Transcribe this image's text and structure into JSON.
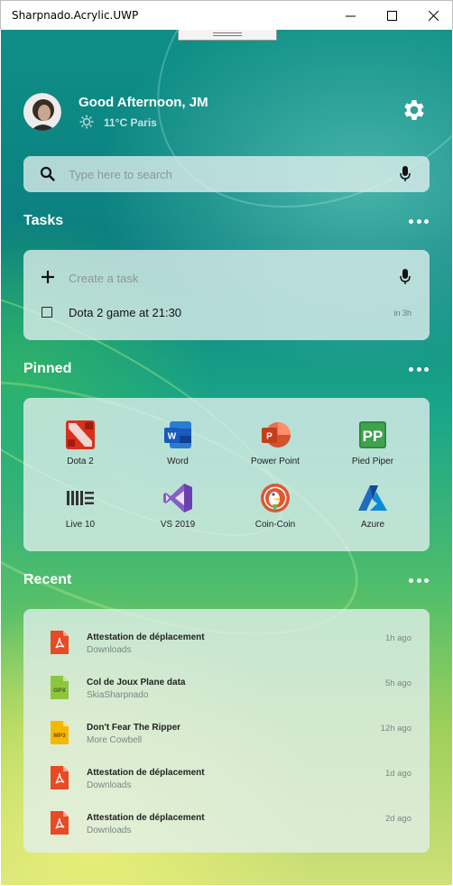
{
  "window": {
    "title": "Sharpnado.Acrylic.UWP"
  },
  "header": {
    "greeting": "Good Afternoon, JM",
    "weather": "11°C  Paris"
  },
  "search": {
    "placeholder": "Type here to search"
  },
  "tasks": {
    "title": "Tasks",
    "create_placeholder": "Create a task",
    "items": [
      {
        "label": "Dota 2 game at 21:30",
        "due": "in 3h"
      }
    ]
  },
  "pinned": {
    "title": "Pinned",
    "apps": [
      {
        "label": "Dota 2",
        "icon": "dota2-icon"
      },
      {
        "label": "Word",
        "icon": "word-icon"
      },
      {
        "label": "Power Point",
        "icon": "powerpoint-icon"
      },
      {
        "label": "Pied Piper",
        "icon": "pied-piper-icon"
      },
      {
        "label": "Live 10",
        "icon": "live10-icon"
      },
      {
        "label": "VS 2019",
        "icon": "visual-studio-icon"
      },
      {
        "label": "Coin-Coin",
        "icon": "duckduckgo-icon"
      },
      {
        "label": "Azure",
        "icon": "azure-icon"
      }
    ]
  },
  "recent": {
    "title": "Recent",
    "items": [
      {
        "name": "Attestation de déplacement",
        "location": "Downloads",
        "time": "1h ago",
        "type": "pdf"
      },
      {
        "name": "Col de Joux Plane data",
        "location": "SkiaSharpnado",
        "time": "5h ago",
        "type": "GPX"
      },
      {
        "name": "Don't Fear The Ripper",
        "location": "More Cowbell",
        "time": "12h ago",
        "type": "MP3"
      },
      {
        "name": "Attestation de déplacement",
        "location": "Downloads",
        "time": "1d ago",
        "type": "pdf"
      },
      {
        "name": "Attestation de déplacement",
        "location": "Downloads",
        "time": "2d ago",
        "type": "pdf"
      }
    ]
  },
  "colors": {
    "accent": "#ffffff",
    "card": "#e1f0ee",
    "pdf": "#e84a25",
    "gpx": "#8cc63f",
    "mp3": "#f5b800"
  }
}
